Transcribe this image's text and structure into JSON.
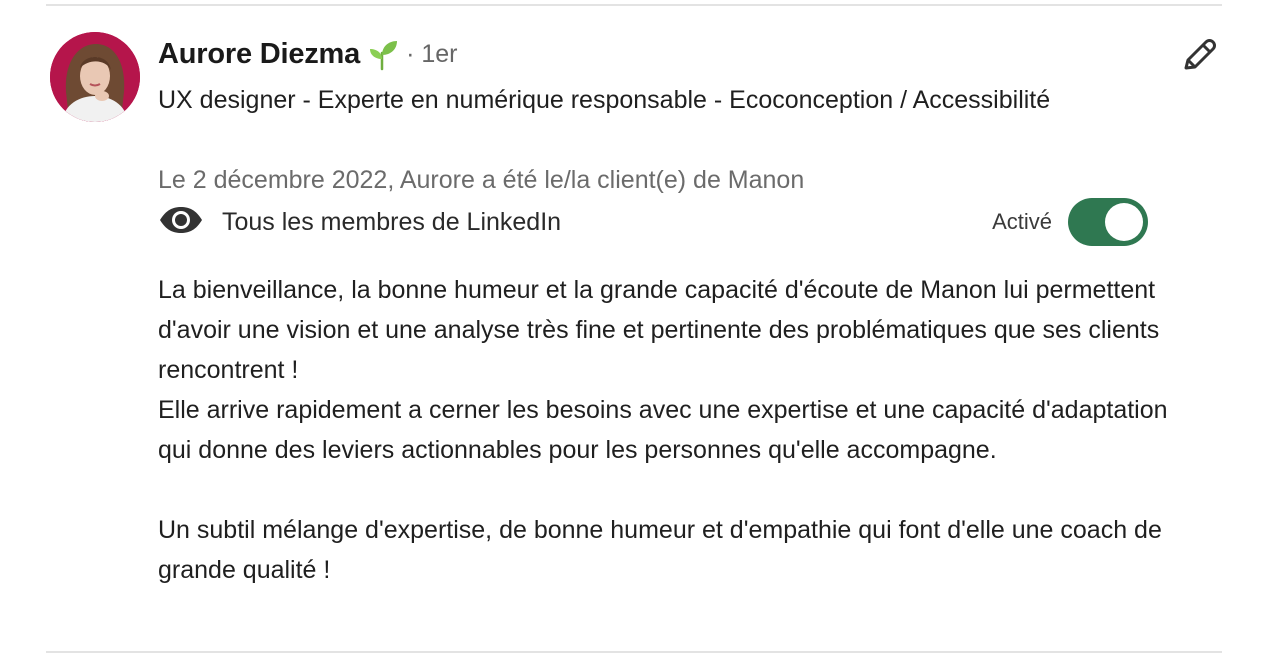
{
  "recommendation": {
    "author": {
      "name": "Aurore Diezma",
      "badge_icon": "sprout-icon",
      "degree": "· 1er",
      "headline": "UX designer - Experte en numérique responsable - Ecoconception / Accessibilité"
    },
    "meta": "Le 2 décembre 2022, Aurore a été le/la client(e) de Manon",
    "visibility": {
      "icon": "eye-icon",
      "label": "Tous les membres de LinkedIn"
    },
    "toggle": {
      "label": "Activé",
      "state": "on",
      "color": "#2f7851"
    },
    "edit_icon": "pencil-icon",
    "text": {
      "lines": [
        "La bienveillance, la bonne humeur et la grande capacité d'écoute de Manon lui permettent d'avoir une vision et une analyse très fine et pertinente des problématiques que ses clients rencontrent !",
        "Elle arrive rapidement a cerner les besoins avec une expertise et une capacité d'adaptation qui donne des leviers actionnables pour les personnes qu'elle accompagne."
      ],
      "closing": "Un subtil mélange d'expertise, de bonne humeur et d'empathie qui font d'elle une coach de grande qualité !"
    }
  }
}
